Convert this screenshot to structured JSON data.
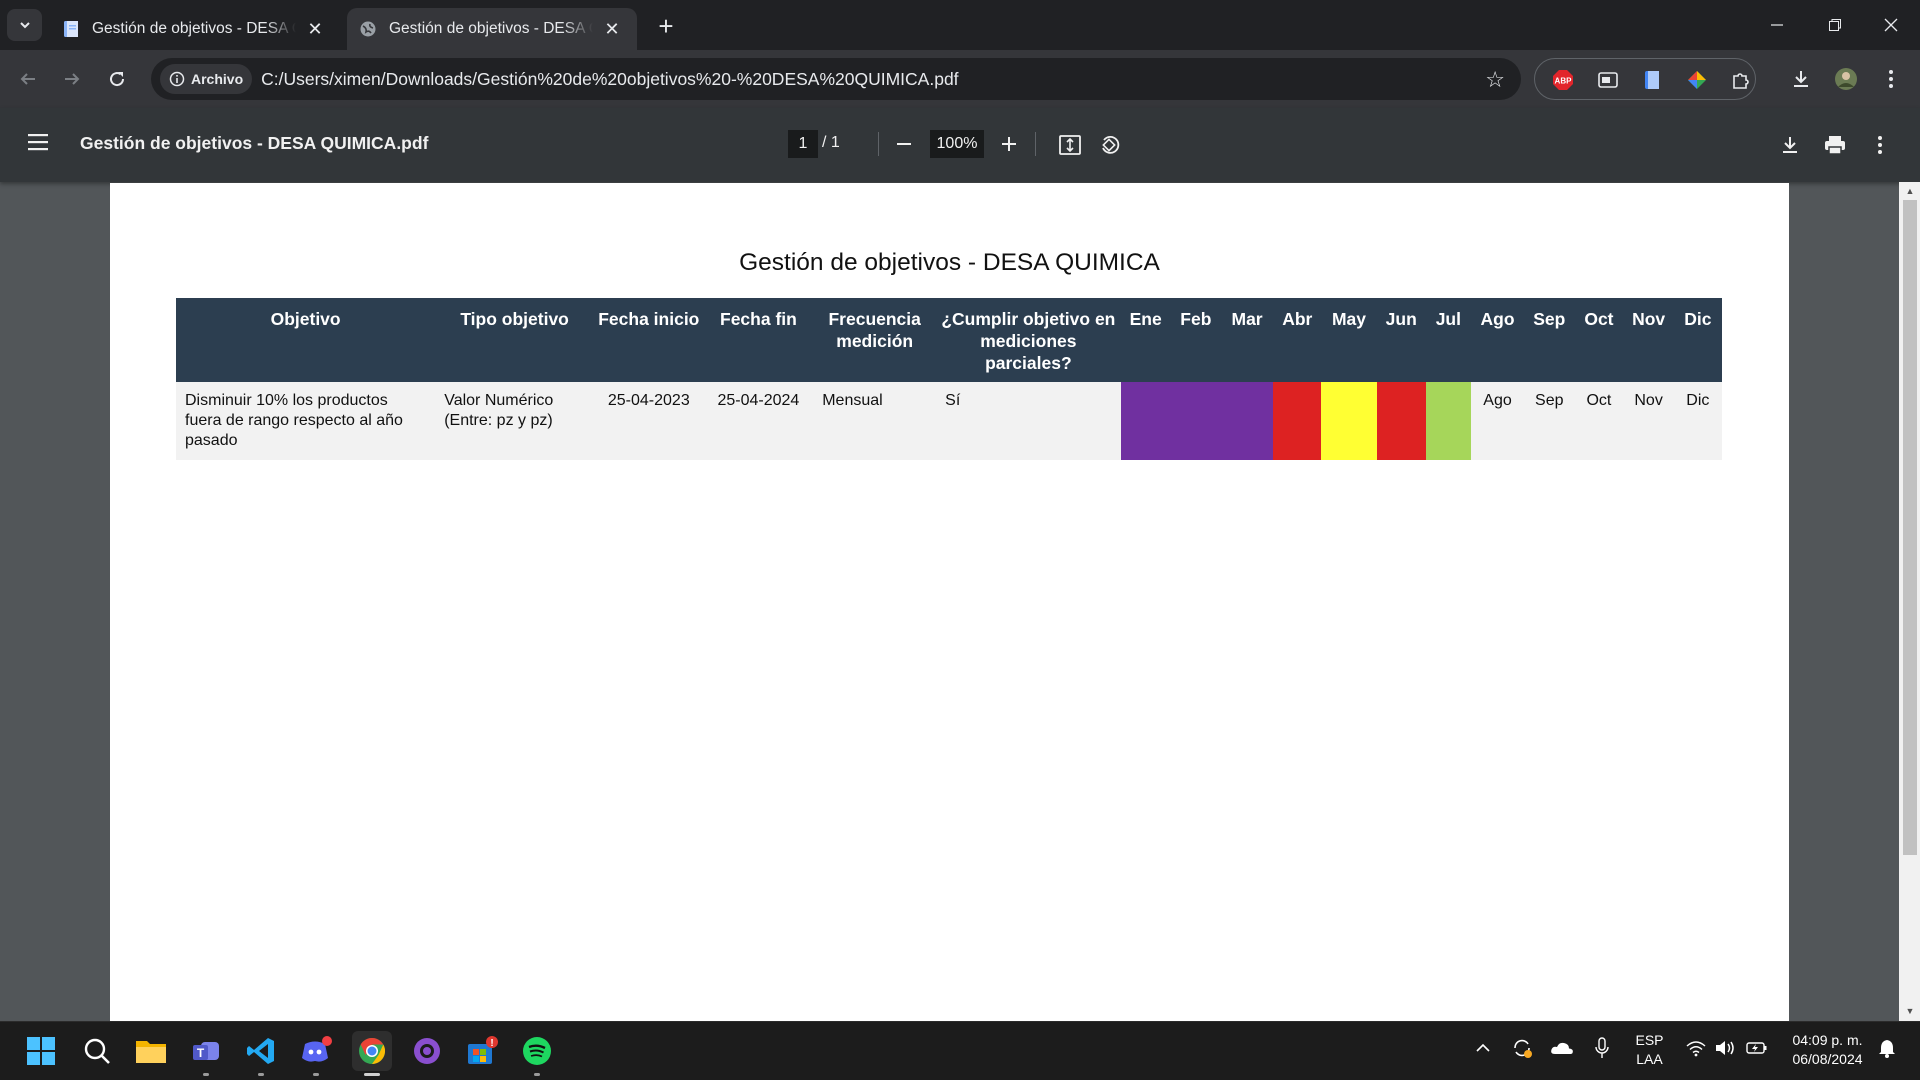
{
  "browser": {
    "tabs": [
      {
        "title": "Gestión de objetivos - DESA QUIMICA.pdf",
        "state": "inactive",
        "icon": "document-icon"
      },
      {
        "title": "Gestión de objetivos - DESA QUIMICA.pdf",
        "state": "active",
        "icon": "globe-icon"
      }
    ],
    "address_chip": "Archivo",
    "url": "C:/Users/ximen/Downloads/Gestión%20de%20objetivos%20-%20DESA%20QUIMICA.pdf",
    "extensions": [
      "adblock-plus-icon",
      "window-extension-icon",
      "docs-extension-icon",
      "color-picker-extension-icon",
      "puzzle-icon"
    ],
    "abp_label": "ABP"
  },
  "pdf_viewer": {
    "file_name": "Gestión de objetivos - DESA QUIMICA.pdf",
    "current_page": "1",
    "total_pages": "/  1",
    "zoom": "100%"
  },
  "document": {
    "title": "Gestión de objetivos - DESA QUIMICA",
    "headers": [
      "Objetivo",
      "Tipo objetivo",
      "Fecha inicio",
      "Fecha fin",
      "Frecuencia medición",
      "¿Cumplir objetivo en mediciones parciales?",
      "Ene",
      "Feb",
      "Mar",
      "Abr",
      "May",
      "Jun",
      "Jul",
      "Ago",
      "Sep",
      "Oct",
      "Nov",
      "Dic"
    ],
    "rows": [
      {
        "objetivo": "Disminuir 10% los productos fuera de rango respecto al año pasado",
        "tipo_objetivo": "Valor Numérico (Entre: pz y pz)",
        "fecha_inicio": "25-04-2023",
        "fecha_fin": "25-04-2024",
        "frecuencia": "Mensual",
        "cumplir_parciales": "Sí",
        "months": [
          {
            "month": "Ene",
            "text": "",
            "color": "#7030a0"
          },
          {
            "month": "Feb",
            "text": "",
            "color": "#7030a0"
          },
          {
            "month": "Mar",
            "text": "",
            "color": "#7030a0"
          },
          {
            "month": "Abr",
            "text": "",
            "color": "#dd2222"
          },
          {
            "month": "May",
            "text": "",
            "color": "#ffff33"
          },
          {
            "month": "Jun",
            "text": "",
            "color": "#dd2222"
          },
          {
            "month": "Jul",
            "text": "",
            "color": "#a6d65a"
          },
          {
            "month": "Ago",
            "text": "Ago",
            "color": "#f2f2f2"
          },
          {
            "month": "Sep",
            "text": "Sep",
            "color": "#f2f2f2"
          },
          {
            "month": "Oct",
            "text": "Oct",
            "color": "#f2f2f2"
          },
          {
            "month": "Nov",
            "text": "Nov",
            "color": "#f2f2f2"
          },
          {
            "month": "Dic",
            "text": "Dic",
            "color": "#f2f2f2"
          }
        ]
      }
    ]
  },
  "taskbar": {
    "apps": [
      "windows-start-icon",
      "search-icon",
      "file-explorer-icon",
      "teams-icon",
      "vscode-icon",
      "discord-icon",
      "chrome-icon",
      "github-desktop-icon",
      "microsoft-store-icon",
      "spotify-icon"
    ],
    "language": "ESP",
    "layout": "LAA",
    "time": "04:09 p. m.",
    "date": "06/08/2024"
  },
  "colors": {
    "header_bg": "#2c3e50",
    "row_bg": "#f2f2f2",
    "viewer_bg": "#525659"
  }
}
